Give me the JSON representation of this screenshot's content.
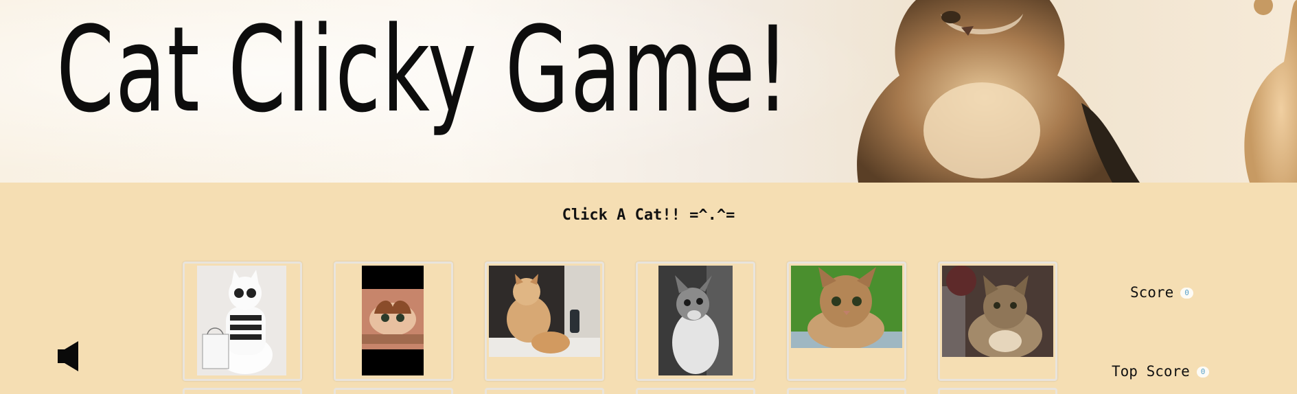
{
  "header": {
    "title": "Cat Clicky Game!"
  },
  "instructions": "Click A Cat!! =^.^=",
  "score": {
    "label": "Score",
    "value": "0"
  },
  "top_score": {
    "label": "Top Score",
    "value": "0"
  },
  "sound": {
    "icon": "speaker-icon"
  },
  "cards": [
    {
      "name": "cat-card-sunglasses",
      "icon": "white-cat-with-sunglasses"
    },
    {
      "name": "cat-card-peeking",
      "icon": "calico-cat-peeking"
    },
    {
      "name": "cat-card-fluffy",
      "icon": "fluffy-ginger-cat"
    },
    {
      "name": "cat-card-bw",
      "icon": "black-white-cat-looking-up"
    },
    {
      "name": "cat-card-tabby-grass",
      "icon": "tabby-cat-on-grass"
    },
    {
      "name": "cat-card-tabby-room",
      "icon": "tabby-cat-indoors"
    }
  ],
  "colors": {
    "background": "#f5deb3",
    "card_border": "#e9e4dc",
    "badge_text": "#5ba2c9"
  }
}
